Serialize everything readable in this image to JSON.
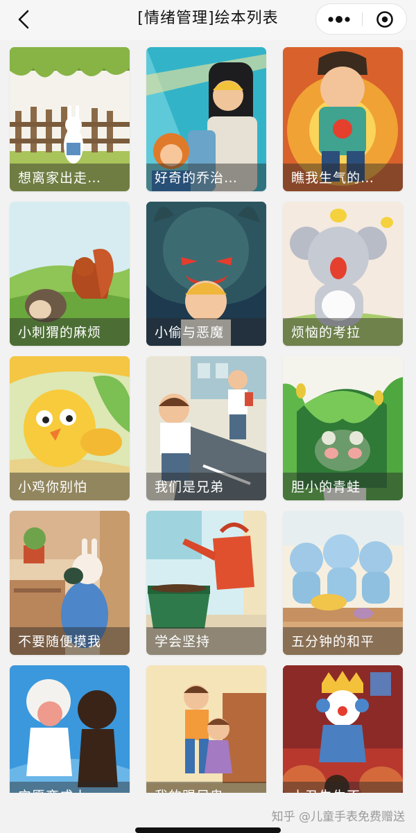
{
  "navbar": {
    "title": "[情绪管理]绘本列表",
    "back_icon": "chevron-left-icon",
    "more_icon": "more-dots-icon",
    "close_icon": "target-close-icon"
  },
  "books": [
    {
      "title": "想离家出走…",
      "icon": "rabbit-fence-illustration"
    },
    {
      "title": "好奇的乔治…",
      "icon": "monkey-guitar-illustration"
    },
    {
      "title": "瞧我生气的…",
      "icon": "angry-boy-illustration"
    },
    {
      "title": "小刺猬的麻烦",
      "icon": "hedgehog-squirrel-illustration"
    },
    {
      "title": "小偷与恶魔",
      "icon": "boy-monster-illustration"
    },
    {
      "title": "烦恼的考拉",
      "icon": "koala-illustration"
    },
    {
      "title": "小鸡你别怕",
      "icon": "chick-illustration"
    },
    {
      "title": "我们是兄弟",
      "icon": "brothers-illustration"
    },
    {
      "title": "胆小的青蛙",
      "icon": "frog-illustration"
    },
    {
      "title": "不要随便摸我",
      "icon": "rabbit-room-illustration"
    },
    {
      "title": "学会坚持",
      "icon": "watering-can-illustration"
    },
    {
      "title": "五分钟的和平",
      "icon": "elephants-illustration"
    },
    {
      "title": "宁愿变成小…",
      "icon": "girl-shadow-illustration"
    },
    {
      "title": "我的踢足鬼…",
      "icon": "kids-playing-illustration"
    },
    {
      "title": "小丑失生不…",
      "icon": "clown-illustration"
    }
  ],
  "footer": {
    "watermark": "知乎 @儿童手表免费赠送"
  },
  "colors": {
    "navbar_bg": "#f6f6f6",
    "page_bg": "#f2f2f2",
    "caption_overlay": "rgba(40,40,40,0.45)"
  }
}
